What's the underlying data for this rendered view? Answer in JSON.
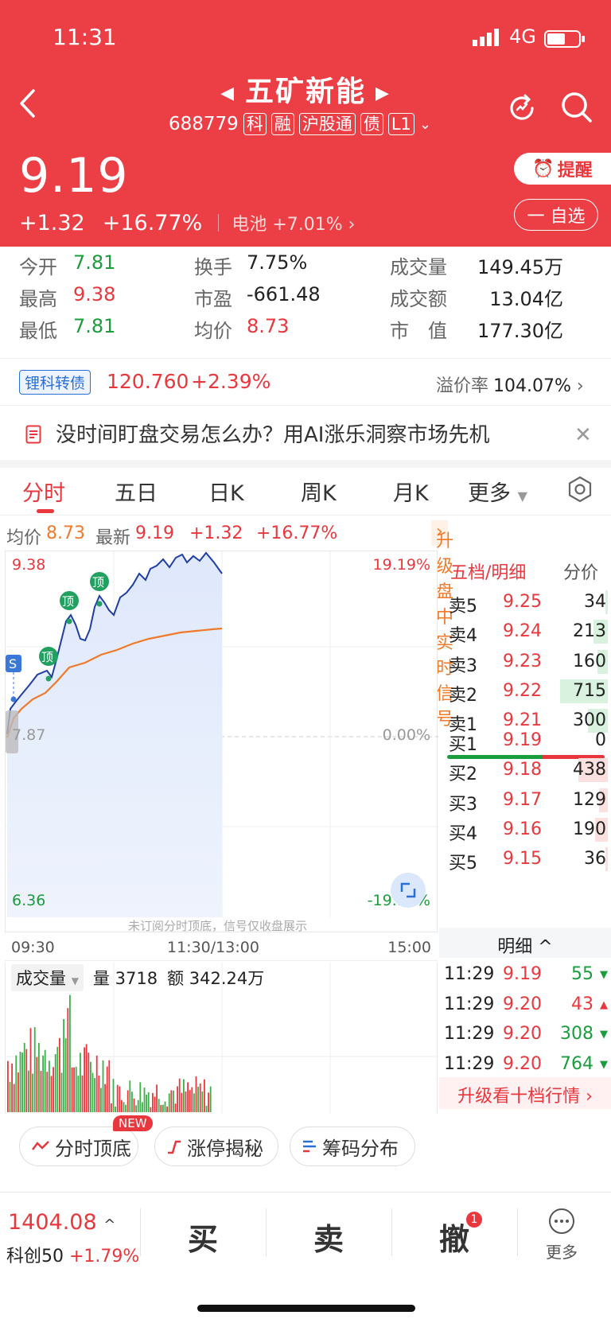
{
  "status_bar": {
    "time": "11:31",
    "network": "4G"
  },
  "header": {
    "title": "五矿新能",
    "code": "688779",
    "tags": [
      "科",
      "融",
      "沪股通",
      "债",
      "L1"
    ],
    "price": "9.19",
    "change": "+1.32",
    "change_pct": "+16.77%",
    "sector": "电池",
    "sector_pct": "+7.01%",
    "remind_label": "提醒",
    "watch_label": "一 自选"
  },
  "stats": {
    "open_label": "今开",
    "open": "7.81",
    "high_label": "最高",
    "high": "9.38",
    "low_label": "最低",
    "low": "7.81",
    "turnover_label": "换手",
    "turnover": "7.75%",
    "pe_label": "市盈",
    "pe": "-661.48",
    "avg_label": "均价",
    "avg": "8.73",
    "volume_label": "成交量",
    "volume": "149.45万",
    "amount_label": "成交额",
    "amount": "13.04亿",
    "mcap_label": "市　值",
    "mcap": "177.30亿"
  },
  "bond": {
    "name": "锂科转债",
    "price": "120.760",
    "change_pct": "+2.39%",
    "premium_label": "溢价率",
    "premium": "104.07%"
  },
  "ad": {
    "text": "没时间盯盘交易怎么办？用AI涨乐洞察市场先机"
  },
  "tabs": [
    "分时",
    "五日",
    "日K",
    "周K",
    "月K",
    "更多"
  ],
  "quote_line": {
    "avg_label": "均价",
    "avg": "8.73",
    "latest_label": "最新",
    "latest": "9.19",
    "change": "+1.32",
    "change_pct": "+16.77%",
    "signal_upgrade": "升级盘中实时信号"
  },
  "chart": {
    "y_max": "9.38",
    "y_mid": "7.87",
    "y_min": "6.36",
    "pct_max": "19.19%",
    "pct_mid": "0.00%",
    "pct_min": "-19.19%",
    "time_start": "09:30",
    "time_mid": "11:30/13:00",
    "time_end": "15:00",
    "note": "未订阅分时顶底，信号仅收盘展示",
    "signal_top": "顶",
    "signal_s": "S"
  },
  "volume": {
    "selector": "成交量",
    "vol_label": "量",
    "vol": "3718",
    "amt_label": "额",
    "amt": "342.24万"
  },
  "order_book": {
    "title": "五档/明细",
    "price_tab": "分价",
    "asks": [
      {
        "label": "卖5",
        "price": "9.25",
        "vol": "34"
      },
      {
        "label": "卖4",
        "price": "9.24",
        "vol": "213"
      },
      {
        "label": "卖3",
        "price": "9.23",
        "vol": "160"
      },
      {
        "label": "卖2",
        "price": "9.22",
        "vol": "715"
      },
      {
        "label": "卖1",
        "price": "9.21",
        "vol": "300"
      }
    ],
    "bids": [
      {
        "label": "买1",
        "price": "9.19",
        "vol": "0"
      },
      {
        "label": "买2",
        "price": "9.18",
        "vol": "438"
      },
      {
        "label": "买3",
        "price": "9.17",
        "vol": "129"
      },
      {
        "label": "买4",
        "price": "9.16",
        "vol": "190"
      },
      {
        "label": "买5",
        "price": "9.15",
        "vol": "36"
      }
    ],
    "detail_label": "明细",
    "trades": [
      {
        "time": "11:29",
        "price": "9.19",
        "vol": "55",
        "dir": "down"
      },
      {
        "time": "11:29",
        "price": "9.20",
        "vol": "43",
        "dir": "up"
      },
      {
        "time": "11:29",
        "price": "9.20",
        "vol": "308",
        "dir": "down"
      },
      {
        "time": "11:29",
        "price": "9.20",
        "vol": "764",
        "dir": "down"
      }
    ],
    "upgrade_depth": "升级看十档行情"
  },
  "tools": {
    "new_badge": "NEW",
    "top_bottom": "分时顶底",
    "limit_up": "涨停揭秘",
    "chips": "筹码分布"
  },
  "bottom_bar": {
    "index_value": "1404.08",
    "index_name": "科创50",
    "index_pct": "+1.79%",
    "buy": "买",
    "sell": "卖",
    "cancel": "撤",
    "cancel_badge": "1",
    "more": "更多"
  },
  "colors": {
    "header_red": "#ec3f45",
    "rise": "#e8383d",
    "fall": "#1a9d3c",
    "avg_line": "#f07a2a",
    "price_line": "#1f3fa6"
  }
}
